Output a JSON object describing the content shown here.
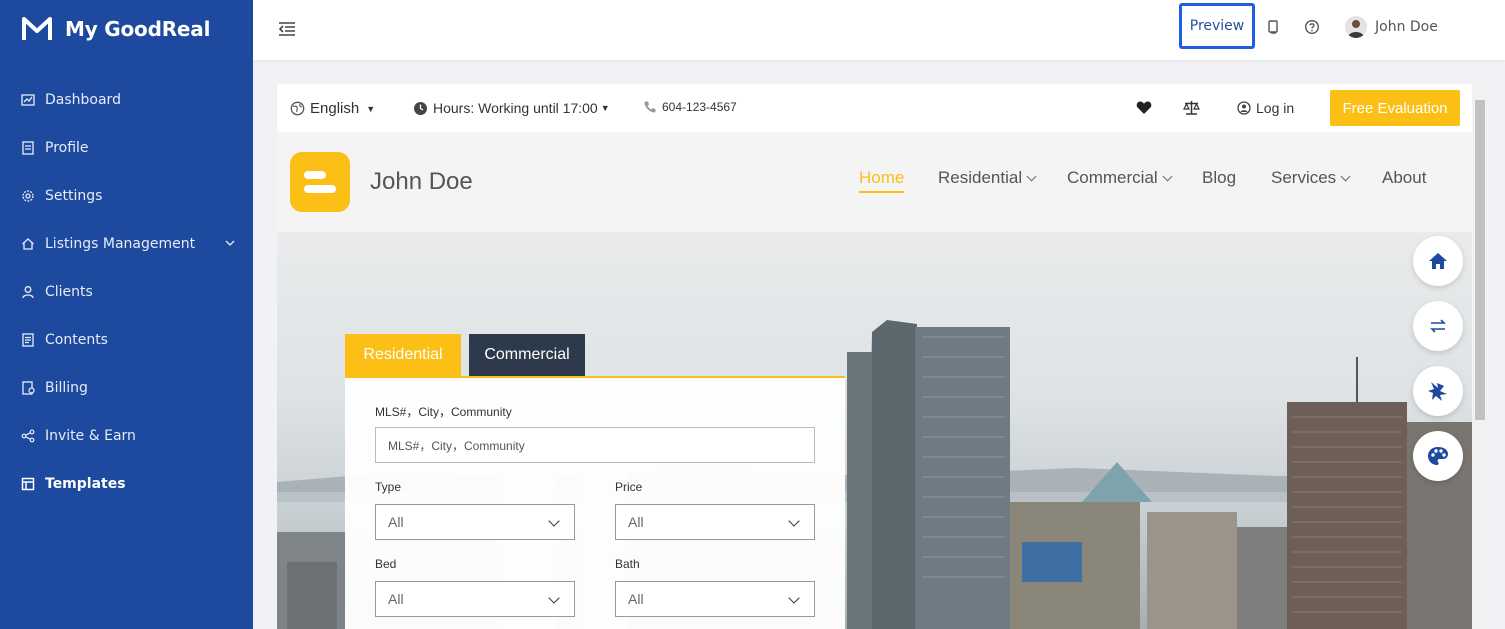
{
  "app": {
    "name": "My GoodReal"
  },
  "sidebar": {
    "items": [
      {
        "label": "Dashboard",
        "icon": "chart-icon"
      },
      {
        "label": "Profile",
        "icon": "document-icon"
      },
      {
        "label": "Settings",
        "icon": "gear-icon"
      },
      {
        "label": "Listings Management",
        "icon": "home-icon",
        "expandable": true
      },
      {
        "label": "Clients",
        "icon": "user-icon"
      },
      {
        "label": "Contents",
        "icon": "document-icon"
      },
      {
        "label": "Billing",
        "icon": "billing-icon"
      },
      {
        "label": "Invite & Earn",
        "icon": "share-icon"
      },
      {
        "label": "Templates",
        "icon": "template-icon",
        "active": true
      }
    ]
  },
  "topbar": {
    "preview_label": "Preview",
    "user_name": "John Doe"
  },
  "site": {
    "top": {
      "language": "English",
      "hours": "Hours: Working until 17:00",
      "phone": "604-123-4567",
      "login": "Log in",
      "cta": "Free Evaluation"
    },
    "header": {
      "name": "John Doe",
      "nav": [
        "Home",
        "Residential",
        "Commercial",
        "Blog",
        "Services",
        "About"
      ],
      "active": "Home"
    },
    "search": {
      "tabs": [
        "Residential",
        "Commercial"
      ],
      "keyword_label": "MLS#，City，Community",
      "keyword_placeholder": "MLS#，City，Community",
      "type_label": "Type",
      "type_value": "All",
      "price_label": "Price",
      "price_value": "All",
      "bed_label": "Bed",
      "bed_value": "All",
      "bath_label": "Bath",
      "bath_value": "All"
    },
    "colors": {
      "accent": "#fbbf16",
      "dark": "#2d3a4b",
      "sidebar": "#1d4a9e"
    }
  }
}
